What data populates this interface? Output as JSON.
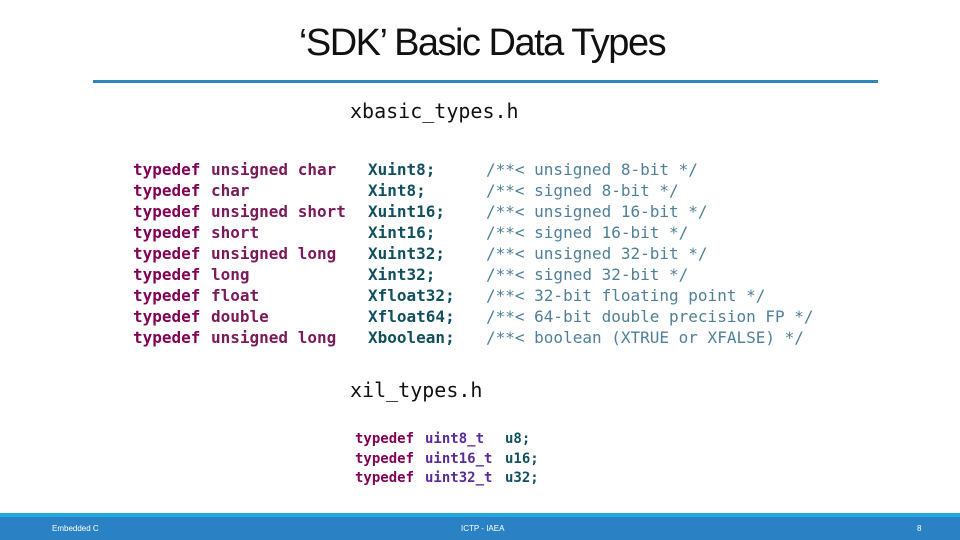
{
  "title": "‘SDK’ Basic Data Types",
  "xbasic": {
    "filename": "xbasic_types.h",
    "rows": [
      {
        "kw": "typedef",
        "base": "unsigned char",
        "name": "Xuint8;",
        "comment": "/**< unsigned 8-bit */"
      },
      {
        "kw": "typedef",
        "base": "char",
        "name": "Xint8;",
        "comment": "/**< signed 8-bit */"
      },
      {
        "kw": "typedef",
        "base": "unsigned short",
        "name": "Xuint16;",
        "comment": "/**< unsigned 16-bit */"
      },
      {
        "kw": "typedef",
        "base": "short",
        "name": "Xint16;",
        "comment": "/**< signed 16-bit */"
      },
      {
        "kw": "typedef",
        "base": "unsigned long",
        "name": "Xuint32;",
        "comment": "/**< unsigned 32-bit */"
      },
      {
        "kw": "typedef",
        "base": "long",
        "name": "Xint32;",
        "comment": "/**< signed 32-bit */"
      },
      {
        "kw": "typedef",
        "base": "float",
        "name": "Xfloat32;",
        "comment": "/**< 32-bit floating point */"
      },
      {
        "kw": "typedef",
        "base": "double",
        "name": "Xfloat64;",
        "comment": "/**< 64-bit double precision FP */"
      },
      {
        "kw": "typedef",
        "base": "unsigned long",
        "name": "Xboolean;",
        "comment": "/**< boolean (XTRUE or XFALSE) */"
      }
    ]
  },
  "xil": {
    "filename": "xil_types.h",
    "rows": [
      {
        "kw": "typedef",
        "base": "uint8_t",
        "name": "u8;"
      },
      {
        "kw": "typedef",
        "base": "uint16_t",
        "name": "u16;"
      },
      {
        "kw": "typedef",
        "base": "uint32_t",
        "name": "u32;"
      }
    ]
  },
  "footer": {
    "left": "Embedded C",
    "center": "ICTP - IAEA",
    "page": "8"
  },
  "colors": {
    "rule": "#2e86c1",
    "footer": "#2a81c3",
    "footer_strip": "#1fa9e1",
    "keyword": "#7f0055"
  }
}
